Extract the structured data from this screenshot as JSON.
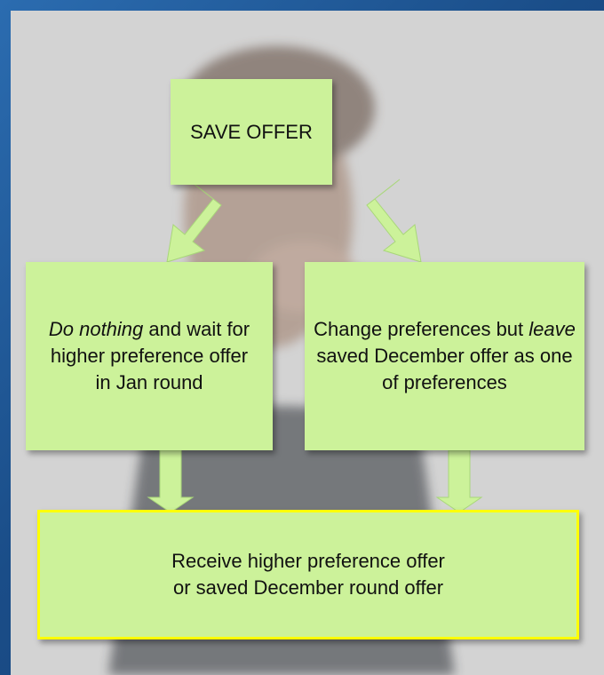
{
  "diagram": {
    "top_box": {
      "label": "SAVE OFFER"
    },
    "left_box": {
      "emphasis": "Do nothing",
      "rest": " and wait for higher preference offer in Jan round"
    },
    "right_box": {
      "lead": "Change preferences but ",
      "emphasis": "leave",
      "rest": " saved December offer as one of preferences"
    },
    "result_box": {
      "line1": "Receive higher preference offer",
      "line2": "or saved December round offer"
    }
  },
  "colors": {
    "box_fill": "#ccf29a",
    "result_border": "#ffff00",
    "background": "#d3d3d3",
    "frame": "#1d4f8a"
  }
}
